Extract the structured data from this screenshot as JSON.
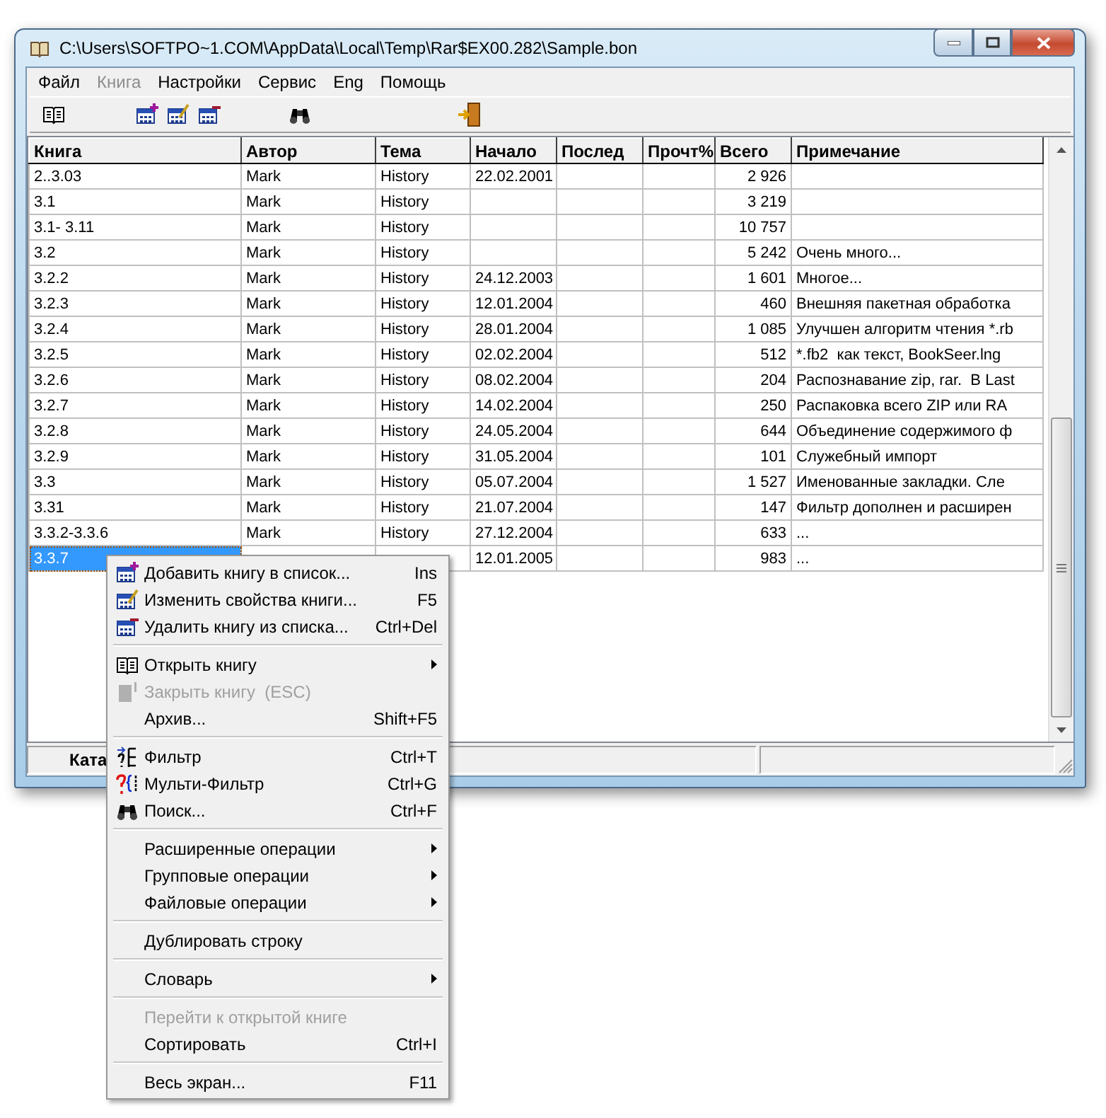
{
  "window": {
    "title": "C:\\Users\\SOFTPO~1.COM\\AppData\\Local\\Temp\\Rar$EX00.282\\Sample.bon"
  },
  "menu_bar": [
    {
      "label": "Файл",
      "disabled": false
    },
    {
      "label": "Книга",
      "disabled": true
    },
    {
      "label": "Настройки",
      "disabled": false
    },
    {
      "label": "Сервис",
      "disabled": false
    },
    {
      "label": "Eng",
      "disabled": false
    },
    {
      "label": "Помощь",
      "disabled": false
    }
  ],
  "table": {
    "columns": [
      "Книга",
      "Автор",
      "Тема",
      "Начало",
      "Послед",
      "Прочт%",
      "Всего",
      "Примечание"
    ],
    "rows": [
      {
        "selected": false,
        "cells": [
          "2..3.03",
          "Mark",
          "History",
          "22.02.2001",
          "",
          "",
          "2 926",
          ""
        ]
      },
      {
        "selected": false,
        "cells": [
          "3.1",
          "Mark",
          "History",
          "",
          "",
          "",
          "3 219",
          ""
        ]
      },
      {
        "selected": false,
        "cells": [
          "3.1- 3.11",
          "Mark",
          "History",
          "",
          "",
          "",
          "10 757",
          ""
        ]
      },
      {
        "selected": false,
        "cells": [
          "3.2",
          "Mark",
          "History",
          "",
          "",
          "",
          "5 242",
          "Очень много..."
        ]
      },
      {
        "selected": false,
        "cells": [
          "3.2.2",
          "Mark",
          "History",
          "24.12.2003",
          "",
          "",
          "1 601",
          "Многое..."
        ]
      },
      {
        "selected": false,
        "cells": [
          "3.2.3",
          "Mark",
          "History",
          "12.01.2004",
          "",
          "",
          "460",
          "Внешняя пакетная обработка"
        ]
      },
      {
        "selected": false,
        "cells": [
          "3.2.4",
          "Mark",
          "History",
          "28.01.2004",
          "",
          "",
          "1 085",
          "Улучшен алгоритм чтения *.rb"
        ]
      },
      {
        "selected": false,
        "cells": [
          "3.2.5",
          "Mark",
          "History",
          "02.02.2004",
          "",
          "",
          "512",
          "*.fb2  как текст, BookSeer.lng"
        ]
      },
      {
        "selected": false,
        "cells": [
          "3.2.6",
          "Mark",
          "History",
          "08.02.2004",
          "",
          "",
          "204",
          "Распознавание zip, rar.  B Last"
        ]
      },
      {
        "selected": false,
        "cells": [
          "3.2.7",
          "Mark",
          "History",
          "14.02.2004",
          "",
          "",
          "250",
          "Распаковка всего ZIP или RA"
        ]
      },
      {
        "selected": false,
        "cells": [
          "3.2.8",
          "Mark",
          "History",
          "24.05.2004",
          "",
          "",
          "644",
          "Объединение содержимого ф"
        ]
      },
      {
        "selected": false,
        "cells": [
          "3.2.9",
          "Mark",
          "History",
          "31.05.2004",
          "",
          "",
          "101",
          "Служебный импорт"
        ]
      },
      {
        "selected": false,
        "cells": [
          "3.3",
          "Mark",
          "History",
          "05.07.2004",
          "",
          "",
          "1 527",
          "Именованные закладки. Сле"
        ]
      },
      {
        "selected": false,
        "cells": [
          "3.31",
          "Mark",
          "History",
          "21.07.2004",
          "",
          "",
          "147",
          "Фильтр дополнен и расширен"
        ]
      },
      {
        "selected": false,
        "cells": [
          "3.3.2-3.3.6",
          "Mark",
          "History",
          "27.12.2004",
          "",
          "",
          "633",
          "..."
        ]
      },
      {
        "selected": true,
        "cells": [
          "3.3.7",
          "",
          "",
          "12.01.2005",
          "",
          "",
          "983",
          "..."
        ]
      }
    ]
  },
  "status_bar": [
    "Ката"
  ],
  "context_menu": [
    [
      {
        "label": "Добавить книгу в список...",
        "shortcut": "Ins",
        "submenu": false,
        "disabled": false
      },
      {
        "label": "Изменить свойства книги...",
        "shortcut": "F5",
        "submenu": false,
        "disabled": false
      },
      {
        "label": "Удалить книгу из списка...",
        "shortcut": "Ctrl+Del",
        "submenu": false,
        "disabled": false
      }
    ],
    [
      {
        "label": "Открыть книгу",
        "submenu": true,
        "disabled": false
      },
      {
        "label": "Закрыть книгу  (ESC)",
        "submenu": false,
        "disabled": true
      },
      {
        "label": "Архив...",
        "shortcut": "Shift+F5",
        "submenu": false,
        "disabled": false
      }
    ],
    [
      {
        "label": "Фильтр",
        "shortcut": "Ctrl+T",
        "submenu": false,
        "disabled": false
      },
      {
        "label": "Мульти-Фильтр",
        "shortcut": "Ctrl+G",
        "submenu": false,
        "disabled": false
      },
      {
        "label": "Поиск...",
        "shortcut": "Ctrl+F",
        "submenu": false,
        "disabled": false
      }
    ],
    [
      {
        "label": "Расширенные операции",
        "submenu": true,
        "disabled": false
      },
      {
        "label": "Групповые операции",
        "submenu": true,
        "disabled": false
      },
      {
        "label": "Файловые операции",
        "submenu": true,
        "disabled": false
      }
    ],
    [
      {
        "label": "Дублировать строку",
        "submenu": false,
        "disabled": false
      }
    ],
    [
      {
        "label": "Словарь",
        "submenu": true,
        "disabled": false
      }
    ],
    [
      {
        "label": "Перейти к открытой книге",
        "submenu": false,
        "disabled": true
      },
      {
        "label": "Сортировать",
        "shortcut": "Ctrl+I",
        "submenu": false,
        "disabled": false
      }
    ],
    [
      {
        "label": "Весь экран...",
        "shortcut": "F11",
        "submenu": false,
        "disabled": false
      }
    ]
  ]
}
